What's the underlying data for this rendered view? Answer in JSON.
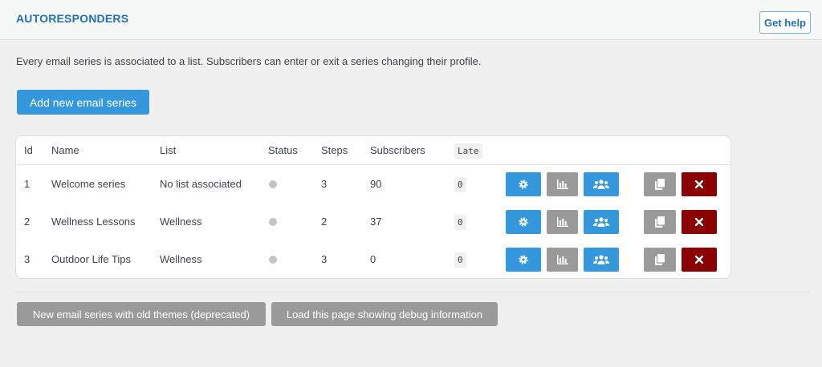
{
  "header": {
    "title": "AUTORESPONDERS",
    "help_label": "Get help"
  },
  "intro_text": "Every email series is associated to a list. Subscribers can enter or exit a series changing their profile.",
  "add_button_label": "Add new email series",
  "table": {
    "columns": {
      "id": "Id",
      "name": "Name",
      "list": "List",
      "status": "Status",
      "steps": "Steps",
      "subscribers": "Subscribers",
      "late": "Late"
    },
    "rows": [
      {
        "id": "1",
        "name": "Welcome series",
        "list": "No list associated",
        "status": "inactive",
        "steps": "3",
        "subscribers": "90",
        "late": "0"
      },
      {
        "id": "2",
        "name": "Wellness Lessons",
        "list": "Wellness",
        "status": "inactive",
        "steps": "2",
        "subscribers": "37",
        "late": "0"
      },
      {
        "id": "3",
        "name": "Outdoor Life Tips",
        "list": "Wellness",
        "status": "inactive",
        "steps": "3",
        "subscribers": "0",
        "late": "0"
      }
    ],
    "row_actions": [
      "gear-icon",
      "chart-icon",
      "users-icon",
      "copy-icon",
      "delete-icon"
    ]
  },
  "footer": {
    "old_themes_label": "New email series with old themes (deprecated)",
    "debug_label": "Load this page showing debug information"
  },
  "colors": {
    "primary_blue": "#3598dc",
    "title_blue": "#2271b1",
    "grey_button": "#9a9a9a",
    "delete_red": "#8b0000",
    "status_inactive": "#c3c4c7"
  }
}
